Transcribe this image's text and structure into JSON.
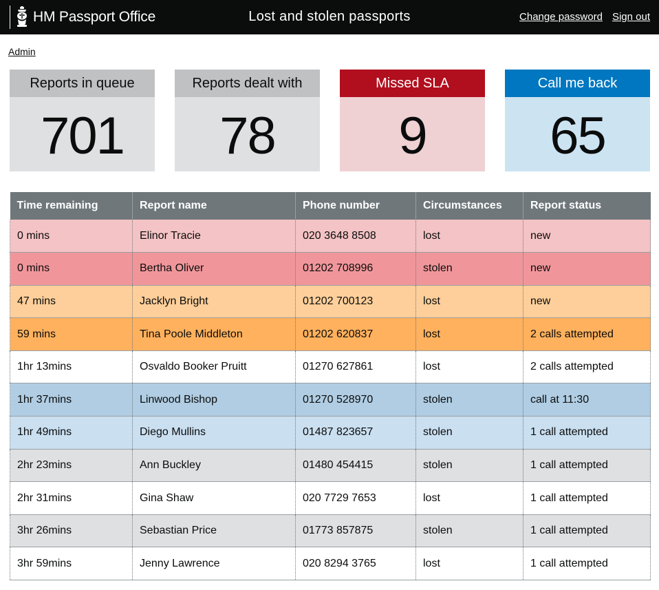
{
  "header": {
    "brand": "HM Passport Office",
    "title": "Lost and stolen passports",
    "links": {
      "change_password": "Change password",
      "sign_out": "Sign out"
    }
  },
  "breadcrumb": {
    "admin": "Admin"
  },
  "stats": [
    {
      "label": "Reports in queue",
      "value": "701",
      "style": "grey"
    },
    {
      "label": "Reports dealt with",
      "value": "78",
      "style": "grey"
    },
    {
      "label": "Missed SLA",
      "value": "9",
      "style": "red",
      "accent": "#b10e1e"
    },
    {
      "label": "Call me back",
      "value": "65",
      "style": "blue",
      "accent": "#0077c0"
    }
  ],
  "table": {
    "headers": [
      "Time remaining",
      "Report name",
      "Phone number",
      "Circumstances",
      "Report status"
    ],
    "rows": [
      {
        "time": "0 mins",
        "name": "Elinor Tracie",
        "phone": "020 3648 8508",
        "circumstance": "lost",
        "status": "new",
        "row_color": "#f4c3c5"
      },
      {
        "time": "0 mins",
        "name": "Bertha Oliver",
        "phone": "01202 708996",
        "circumstance": "stolen",
        "status": "new",
        "row_color": "#f0969b"
      },
      {
        "time": "47 mins",
        "name": "Jacklyn Bright",
        "phone": "01202 700123",
        "circumstance": "lost",
        "status": "new",
        "row_color": "#fecf9a"
      },
      {
        "time": "59 mins",
        "name": "Tina Poole Middleton",
        "phone": "01202 620837",
        "circumstance": "lost",
        "status": "2 calls attempted",
        "row_color": "#ffb15d"
      },
      {
        "time": "1hr 13mins",
        "name": "Osvaldo Booker Pruitt",
        "phone": "01270 627861",
        "circumstance": "lost",
        "status": "2 calls attempted",
        "row_color": "#ffffff"
      },
      {
        "time": "1hr 37mins",
        "name": "Linwood Bishop",
        "phone": "01270 528970",
        "circumstance": "stolen",
        "status": "call at 11:30",
        "row_color": "#b0cde3"
      },
      {
        "time": "1hr 49mins",
        "name": "Diego Mullins",
        "phone": "01487 823657",
        "circumstance": "stolen",
        "status": "1 call attempted",
        "row_color": "#cadff0"
      },
      {
        "time": "2hr 23mins",
        "name": "Ann Buckley",
        "phone": "01480 454415",
        "circumstance": "stolen",
        "status": "1 call attempted",
        "row_color": "#dee0e2"
      },
      {
        "time": "2hr 31mins",
        "name": "Gina Shaw",
        "phone": "020 7729 7653",
        "circumstance": "lost",
        "status": "1 call attempted",
        "row_color": "#ffffff"
      },
      {
        "time": "3hr 26mins",
        "name": "Sebastian Price",
        "phone": "01773 857875",
        "circumstance": "stolen",
        "status": "1 call attempted",
        "row_color": "#dee0e2"
      },
      {
        "time": "3hr 59mins",
        "name": "Jenny Lawrence",
        "phone": "020 8294 3765",
        "circumstance": "lost",
        "status": "1 call attempted",
        "row_color": "#ffffff"
      }
    ]
  }
}
